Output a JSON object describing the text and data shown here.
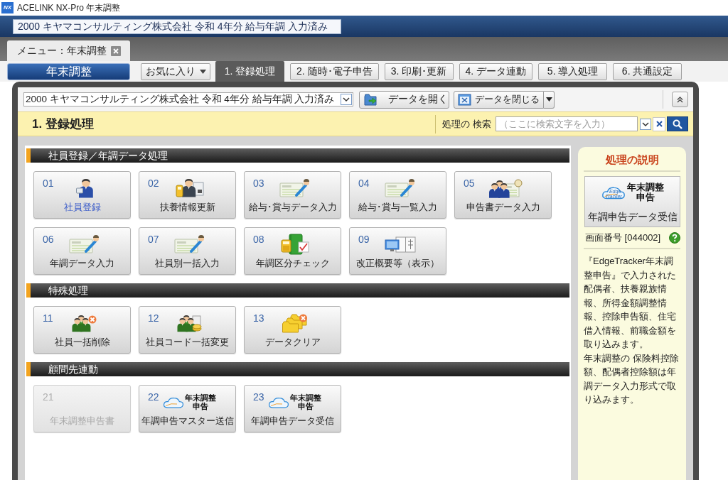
{
  "window": {
    "logo": "NX",
    "title": "ACELINK NX-Pro 年末調整"
  },
  "company_banner": "2000 キヤマコンサルティング株式会社 令和 4年分 給与年調 入力済み",
  "doc_tab": {
    "label": "メニュー：年末調整"
  },
  "menu_button": "年末調整",
  "favorites": "お気に入り",
  "tabs": [
    {
      "label": "1. 登録処理",
      "selected": true
    },
    {
      "label": "2. 随時･電子申告",
      "selected": false
    },
    {
      "label": "3. 印刷･更新",
      "selected": false
    },
    {
      "label": "4. データ連動",
      "selected": false
    },
    {
      "label": "5. 導入処理",
      "selected": false
    },
    {
      "label": "6. 共通設定",
      "selected": false
    }
  ],
  "toolbar": {
    "company_select": "2000 キヤマコンサルティング株式会社 令和 4年分 給与年調 入力済み",
    "open_button": "データを開く",
    "close_button": "データを閉じる"
  },
  "heading": "1. 登録処理",
  "search": {
    "label": "処理の 検索",
    "placeholder": "（ここに検索文字を入力）"
  },
  "groups": [
    {
      "title": "社員登録／年調データ処理",
      "items": [
        {
          "number": "01",
          "label": "社員登録",
          "kind": "person",
          "selected": true,
          "disabled": false
        },
        {
          "number": "02",
          "label": "扶養情報更新",
          "kind": "personcard",
          "selected": false,
          "disabled": false
        },
        {
          "number": "03",
          "label": "給与･賞与データ入力",
          "kind": "form",
          "selected": false,
          "disabled": false
        },
        {
          "number": "04",
          "label": "給与･賞与一覧入力",
          "kind": "form",
          "selected": false,
          "disabled": false
        },
        {
          "number": "05",
          "label": "申告書データ入力",
          "kind": "peopleform",
          "selected": false,
          "disabled": false
        },
        {
          "number": "06",
          "label": "年調データ入力",
          "kind": "form",
          "selected": false,
          "disabled": false
        },
        {
          "number": "07",
          "label": "社員別一括入力",
          "kind": "form",
          "selected": false,
          "disabled": false
        },
        {
          "number": "08",
          "label": "年調区分チェック",
          "kind": "calculator",
          "selected": false,
          "disabled": false
        },
        {
          "number": "09",
          "label": "改正概要等（表示）",
          "kind": "monitor",
          "selected": false,
          "disabled": false
        }
      ]
    },
    {
      "title": "特殊処理",
      "items": [
        {
          "number": "11",
          "label": "社員一括削除",
          "kind": "peopledelete",
          "selected": false,
          "disabled": false
        },
        {
          "number": "12",
          "label": "社員コード一括変更",
          "kind": "peoplecoins",
          "selected": false,
          "disabled": false
        },
        {
          "number": "13",
          "label": "データクリア",
          "kind": "folders",
          "selected": false,
          "disabled": false
        }
      ]
    },
    {
      "title": "顧問先連動",
      "items": [
        {
          "number": "21",
          "label": "年末調整申告書",
          "kind": "blank",
          "selected": false,
          "disabled": true
        },
        {
          "number": "22",
          "label": "年調申告マスター送信",
          "kind": "logo",
          "logo_lines": [
            "年末調整",
            "申告"
          ],
          "selected": false,
          "disabled": false
        },
        {
          "number": "23",
          "label": "年調申告データ受信",
          "kind": "logo",
          "logo_lines": [
            "年末調整",
            "申告"
          ],
          "selected": false,
          "disabled": false
        }
      ]
    }
  ],
  "side_panel": {
    "title": "処理の説明",
    "feature_button": {
      "logo_small": [
        "Edge",
        "Tracker"
      ],
      "logo_lines": [
        "年末調整",
        "申告"
      ],
      "label": "年調申告データ受信"
    },
    "screen_number": "画面番号 [044002]",
    "description": [
      "『EdgeTracker年末調整申告』で入力された配偶者、扶養親族情報、所得金額調整情報、控除申告額、住宅借入情報、前職金額を取り込みます。",
      "年末調整の 保険料控除額、配偶者控除額は年調データ入力形式で取り込みます。"
    ]
  }
}
